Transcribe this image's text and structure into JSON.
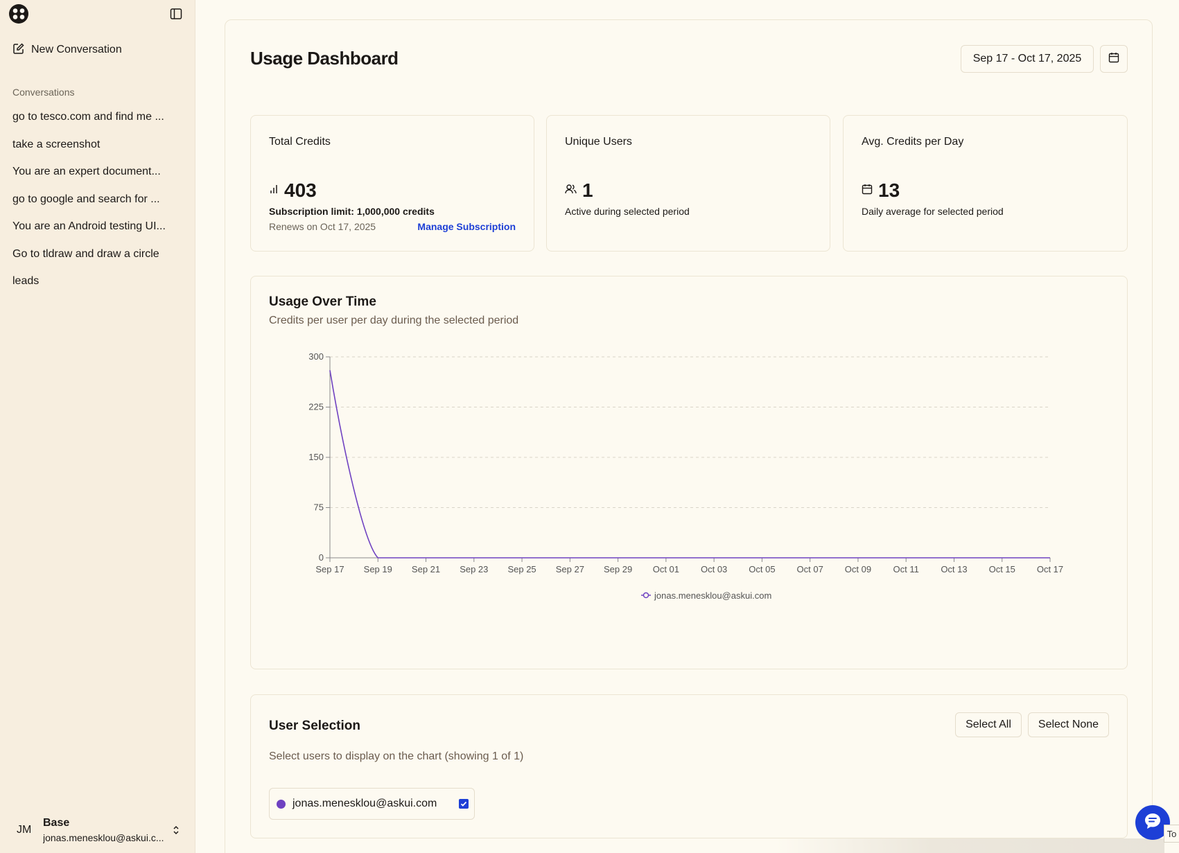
{
  "sidebar": {
    "new_conversation": "New Conversation",
    "conversations_heading": "Conversations",
    "conversations": [
      "go to tesco.com and find me ...",
      "take a screenshot",
      "You are an expert document...",
      "go to google and search for ...",
      "You are an Android testing UI...",
      "Go to tldraw and draw a circle",
      "leads"
    ],
    "user": {
      "initials": "JM",
      "plan": "Base",
      "email": "jonas.menesklou@askui.c..."
    }
  },
  "header": {
    "title": "Usage Dashboard",
    "date_range": "Sep 17 - Oct 17, 2025"
  },
  "stats": {
    "total_credits": {
      "title": "Total Credits",
      "value": "403",
      "limit": "Subscription limit: 1,000,000 credits",
      "renews": "Renews on Oct 17, 2025",
      "manage": "Manage Subscription"
    },
    "unique_users": {
      "title": "Unique Users",
      "value": "1",
      "sub": "Active during selected period"
    },
    "avg_credits": {
      "title": "Avg. Credits per Day",
      "value": "13",
      "sub": "Daily average for selected period"
    }
  },
  "chart_card": {
    "title": "Usage Over Time",
    "subtitle": "Credits per user per day during the selected period"
  },
  "chart_data": {
    "type": "line",
    "title": "Usage Over Time",
    "xlabel": "",
    "ylabel": "",
    "ylim": [
      0,
      300
    ],
    "yticks": [
      0,
      75,
      150,
      225,
      300
    ],
    "x_tick_labels": [
      "Sep 17",
      "Sep 19",
      "Sep 21",
      "Sep 23",
      "Sep 25",
      "Sep 27",
      "Sep 29",
      "Oct 01",
      "Oct 03",
      "Oct 05",
      "Oct 07",
      "Oct 09",
      "Oct 11",
      "Oct 13",
      "Oct 15",
      "Oct 17"
    ],
    "grid": true,
    "legend": "bottom-center",
    "x": [
      "Sep 17",
      "Sep 18",
      "Sep 19",
      "Sep 20",
      "Sep 21",
      "Sep 22",
      "Sep 23",
      "Sep 24",
      "Sep 25",
      "Sep 26",
      "Sep 27",
      "Sep 28",
      "Sep 29",
      "Sep 30",
      "Oct 01",
      "Oct 02",
      "Oct 03",
      "Oct 04",
      "Oct 05",
      "Oct 06",
      "Oct 07",
      "Oct 08",
      "Oct 09",
      "Oct 10",
      "Oct 11",
      "Oct 12",
      "Oct 13",
      "Oct 14",
      "Oct 15",
      "Oct 16",
      "Oct 17"
    ],
    "series": [
      {
        "name": "jonas.menesklou@askui.com",
        "color": "#6f42c1",
        "values": [
          280,
          123,
          0,
          0,
          0,
          0,
          0,
          0,
          0,
          0,
          0,
          0,
          0,
          0,
          0,
          0,
          0,
          0,
          0,
          0,
          0,
          0,
          0,
          0,
          0,
          0,
          0,
          0,
          0,
          0,
          0
        ]
      }
    ]
  },
  "user_selection": {
    "title": "User Selection",
    "select_all": "Select All",
    "select_none": "Select None",
    "subtitle": "Select users to display on the chart (showing 1 of 1)",
    "users": [
      {
        "email": "jonas.menesklou@askui.com",
        "checked": true,
        "color": "#6f42c1"
      }
    ]
  },
  "corner_tab": "To",
  "colors": {
    "accent": "#1d3fd6",
    "series": "#6f42c1",
    "sidebar_bg": "#f7eedf",
    "page_bg": "#fdfaf1"
  }
}
